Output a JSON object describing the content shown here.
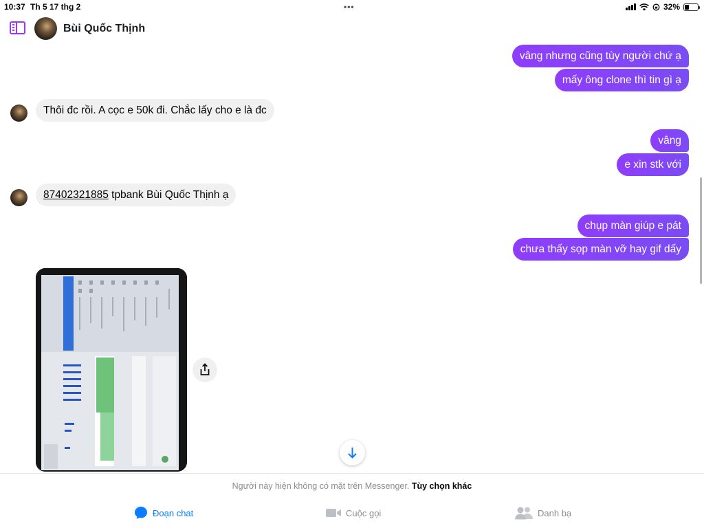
{
  "status_bar": {
    "time": "10:37",
    "date": "Th 5 17 thg 2",
    "battery": "32%",
    "battery_level": 0.32
  },
  "header": {
    "contact_name": "Bùi Quốc Thịnh"
  },
  "messages": {
    "m1": "vâng nhưng cũng tùy người chứ ạ",
    "m2": "mấy ông clone thì tin gì ạ",
    "m3": "Thôi đc rồi. A cọc e 50k đi. Chắc lấy cho e là đc",
    "m4": "vâng",
    "m5": "e xin stk với",
    "m6_account": "87402321885",
    "m6_rest": " tpbank Bùi Quốc Thịnh ạ",
    "m7": "chụp màn giúp e pát",
    "m8": "chưa thấy sọp màn vỡ hay gif dấy"
  },
  "notice": {
    "text": "Người này hiện không có mặt trên Messenger.",
    "link": "Tùy chọn khác"
  },
  "tabs": [
    {
      "label": "Đoạn chat",
      "icon": "chat-bubble-icon",
      "active": true
    },
    {
      "label": "Cuộc gọi",
      "icon": "video-camera-icon",
      "active": false
    },
    {
      "label": "Danh bạ",
      "icon": "people-icon",
      "active": false
    }
  ],
  "colors": {
    "outgoing_bubble": "#8a3ffc",
    "incoming_bubble": "#f0f0f0",
    "active_tab": "#0a7cff",
    "sidebar_icon": "#a033ff"
  }
}
